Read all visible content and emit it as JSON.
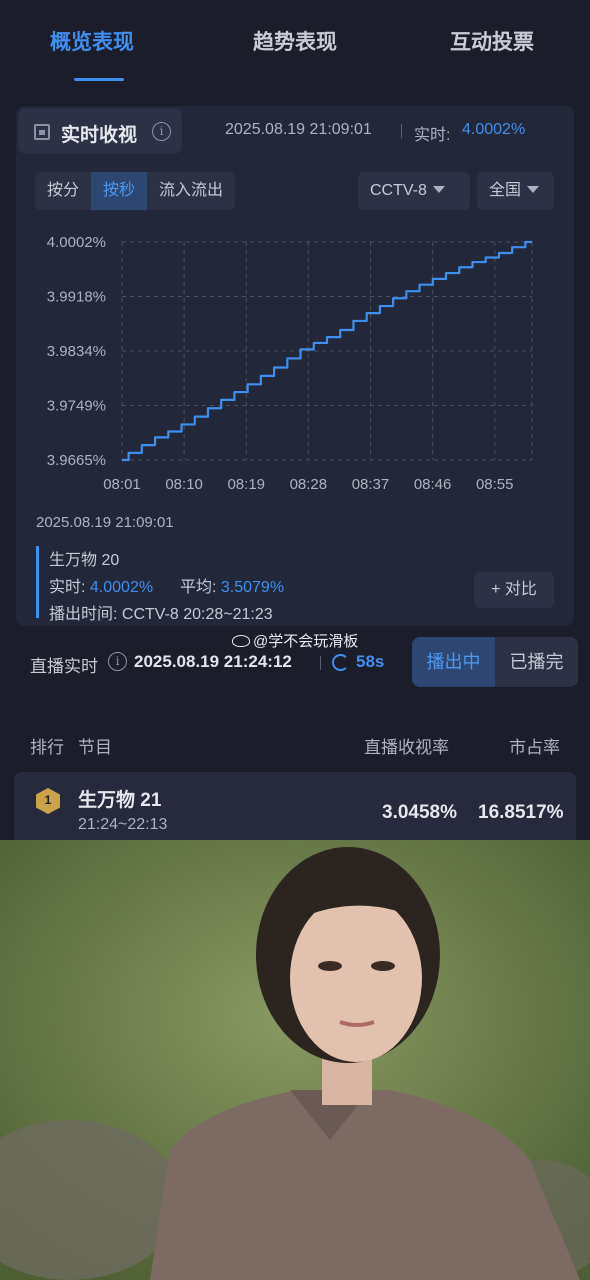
{
  "tabs": [
    "概览表现",
    "趋势表现",
    "互动投票"
  ],
  "realtime": {
    "title": "实时收视",
    "timestamp": "2025.08.19 21:09:01",
    "label": "实时:",
    "value": "4.0002%"
  },
  "segments": [
    "按分",
    "按秒",
    "流入流出"
  ],
  "filters": {
    "channel": "CCTV-8",
    "region": "全国"
  },
  "chart_data": {
    "type": "line",
    "x": [
      "08:01",
      "08:10",
      "08:19",
      "08:28",
      "08:37",
      "08:46",
      "08:55"
    ],
    "yticks": [
      "4.0002%",
      "3.9918%",
      "3.9834%",
      "3.9749%",
      "3.9665%"
    ],
    "ylim": [
      3.9665,
      4.0002
    ],
    "series": [
      {
        "values": [
          [
            0,
            3.9665
          ],
          [
            1,
            3.9676
          ],
          [
            2,
            3.9688
          ],
          [
            3,
            3.97
          ],
          [
            4,
            3.9709
          ],
          [
            5,
            3.972
          ],
          [
            6,
            3.9732
          ],
          [
            7,
            3.9745
          ],
          [
            8,
            3.9758
          ],
          [
            9,
            3.977
          ],
          [
            10,
            3.9782
          ],
          [
            11,
            3.9795
          ],
          [
            12,
            3.9808
          ],
          [
            13,
            3.9822
          ],
          [
            14,
            3.9836
          ],
          [
            15,
            3.9846
          ],
          [
            16,
            3.9855
          ],
          [
            17,
            3.9866
          ],
          [
            18,
            3.988
          ],
          [
            19,
            3.9892
          ],
          [
            20,
            3.9903
          ],
          [
            21,
            3.9915
          ],
          [
            22,
            3.9926
          ],
          [
            23,
            3.9936
          ],
          [
            24,
            3.9945
          ],
          [
            25,
            3.9954
          ],
          [
            26,
            3.9963
          ],
          [
            27,
            3.9971
          ],
          [
            28,
            3.9978
          ],
          [
            29,
            3.9985
          ],
          [
            30,
            3.9994
          ],
          [
            31,
            4.0002
          ]
        ],
        "color": "#3f8ff0"
      }
    ],
    "grid": true
  },
  "tooltip": {
    "time": "2025.08.19 21:09:01",
    "program": "生万物 20",
    "realtime_label": "实时:",
    "realtime_value": "4.0002%",
    "avg_label": "平均:",
    "avg_value": "3.5079%",
    "airtime": "播出时间: CCTV-8 20:28~21:23",
    "compare": "+ 对比"
  },
  "live": {
    "label": "直播实时",
    "timestamp": "2025.08.19 21:24:12",
    "seconds": "58s",
    "watermark": "@学不会玩滑板",
    "toggle": [
      "播出中",
      "已播完"
    ]
  },
  "table": {
    "headers": {
      "rank": "排行",
      "program": "节目",
      "rating": "直播收视率",
      "share": "市占率"
    },
    "rows": [
      {
        "rank": "1",
        "name": "生万物 21",
        "time": "21:24~22:13",
        "rating": "3.0458%",
        "share": "16.8517%"
      }
    ]
  }
}
